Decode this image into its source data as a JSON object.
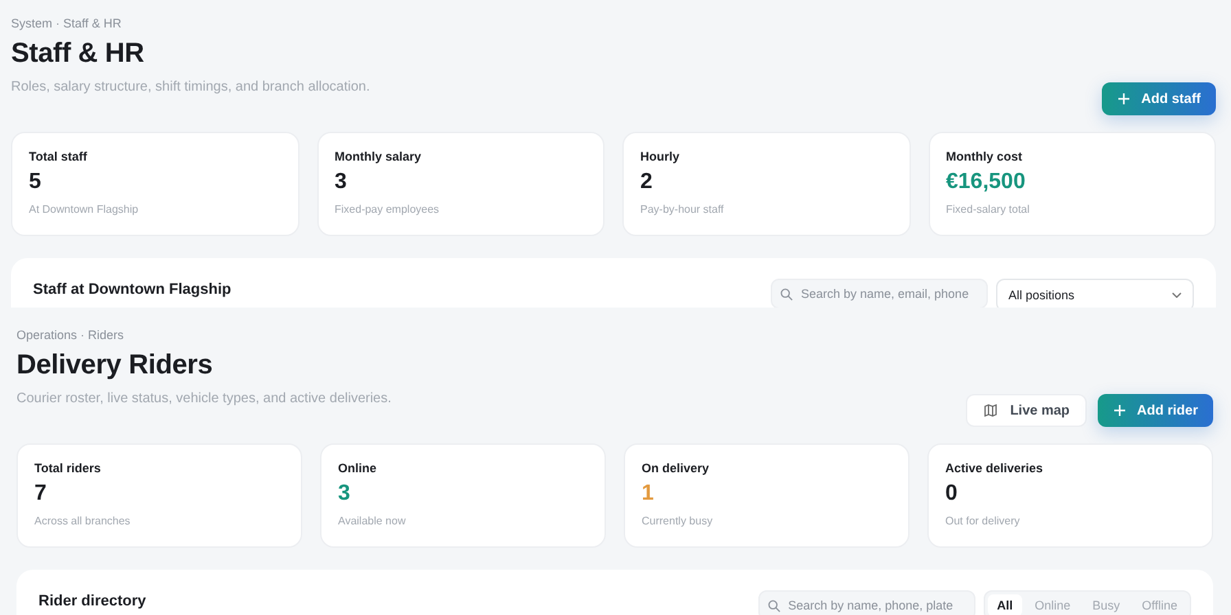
{
  "pages": [
    {
      "breadcrumb": "System · Staff & HR",
      "title": "Staff & HR",
      "subtitle": "Roles, salary structure, shift timings, and branch allocation.",
      "actions": [
        {
          "kind": "primary",
          "label": "Add staff"
        }
      ],
      "stats": [
        {
          "label": "Total staff",
          "value": "5",
          "note": "At Downtown Flagship",
          "color": "#1b1d22"
        },
        {
          "label": "Monthly salary",
          "value": "3",
          "note": "Fixed-pay employees",
          "color": "#1b1d22"
        },
        {
          "label": "Hourly",
          "value": "2",
          "note": "Pay-by-hour staff",
          "color": "#1b1d22"
        },
        {
          "label": "Monthly cost",
          "value": "€16,500",
          "note": "Fixed-salary total",
          "color": "#17957e"
        }
      ],
      "panel": {
        "title": "Staff at Downtown Flagship",
        "search": {
          "placeholder": "Search by name, email, phone"
        },
        "select": {
          "value": "All positions"
        }
      }
    },
    {
      "breadcrumb": "Operations · Riders",
      "title": "Delivery Riders",
      "subtitle": "Courier roster, live status, vehicle types, and active deliveries.",
      "actions": [
        {
          "kind": "map",
          "label": "Live map"
        },
        {
          "kind": "primary",
          "label": "Add rider"
        }
      ],
      "stats": [
        {
          "label": "Total riders",
          "value": "7",
          "note": "Across all branches",
          "color": "#1b1d22"
        },
        {
          "label": "Online",
          "value": "3",
          "note": "Available now",
          "color": "#17957e"
        },
        {
          "label": "On delivery",
          "value": "1",
          "note": "Currently busy",
          "color": "#e39a3f"
        },
        {
          "label": "Active deliveries",
          "value": "0",
          "note": "Out for delivery",
          "color": "#1b1d22"
        }
      ],
      "panel": {
        "title": "Rider directory",
        "search": {
          "placeholder": "Search by name, phone, plate"
        },
        "filters": [
          {
            "label": "All",
            "selected": true
          },
          {
            "label": "Online",
            "selected": false
          },
          {
            "label": "Busy",
            "selected": false
          },
          {
            "label": "Offline",
            "selected": false
          }
        ]
      }
    }
  ]
}
